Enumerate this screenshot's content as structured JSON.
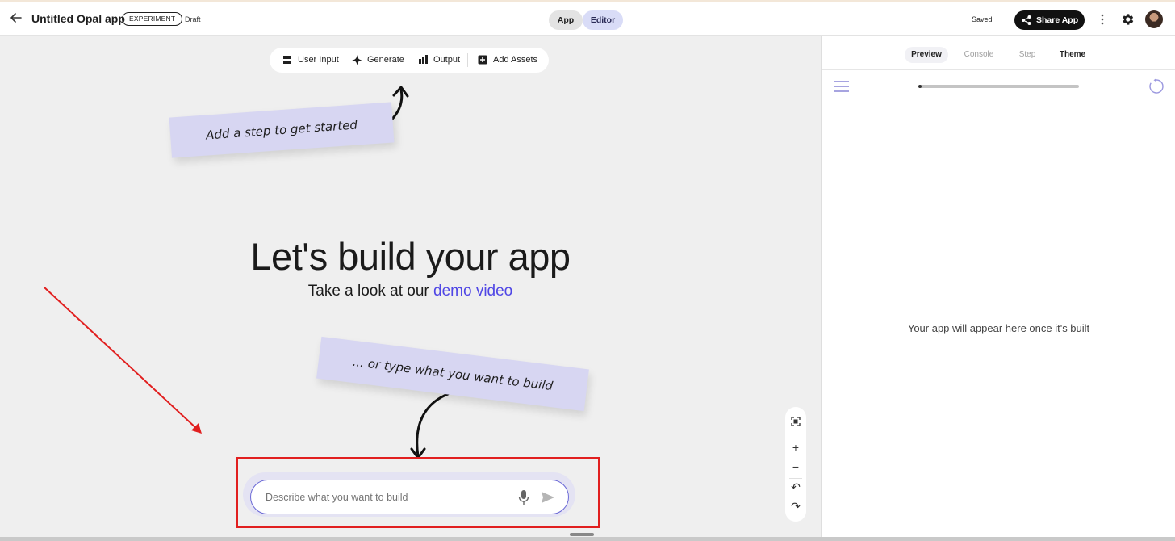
{
  "header": {
    "back_icon": "arrow-left-icon",
    "title": "Untitled Opal app",
    "badge": "EXPERIMENT",
    "status": "Draft",
    "modes": [
      {
        "label": "App",
        "active": false
      },
      {
        "label": "Editor",
        "active": true
      }
    ],
    "saved": "Saved",
    "share_label": "Share App",
    "share_icon": "share-icon",
    "more_icon": "kebab-menu-icon",
    "settings_icon": "gear-icon",
    "avatar": "user-avatar"
  },
  "toolbar": {
    "items": [
      {
        "label": "User Input",
        "icon": "user-input-icon"
      },
      {
        "label": "Generate",
        "icon": "sparkle-icon"
      },
      {
        "label": "Output",
        "icon": "output-icon"
      },
      {
        "label": "Add Assets",
        "icon": "add-box-icon"
      }
    ]
  },
  "notes": {
    "top": "Add a step to get started",
    "bottom": "... or type what you want to build"
  },
  "hero": {
    "title": "Let's build your app",
    "subtitle_prefix": "Take a look at our ",
    "subtitle_link": "demo video"
  },
  "prompt": {
    "placeholder": "Describe what you want to build",
    "mic_icon": "microphone-icon",
    "send_icon": "send-icon"
  },
  "zoom_controls": {
    "items": [
      "fit-view-icon",
      "zoom-in-icon",
      "zoom-out-icon",
      "undo-icon",
      "redo-icon"
    ]
  },
  "panel": {
    "tabs": [
      {
        "label": "Preview",
        "state": "active"
      },
      {
        "label": "Console",
        "state": "disabled"
      },
      {
        "label": "Step",
        "state": "disabled"
      },
      {
        "label": "Theme",
        "state": "normal"
      }
    ],
    "menu_icon": "hamburger-icon",
    "refresh_icon": "refresh-icon",
    "progress": 0.02,
    "empty_message": "Your app will appear here once it's built"
  },
  "colors": {
    "accent": "#4f46e5",
    "note": "#d7d6f2",
    "annotation_red": "#e11f1f",
    "canvas_bg": "#efefef"
  }
}
